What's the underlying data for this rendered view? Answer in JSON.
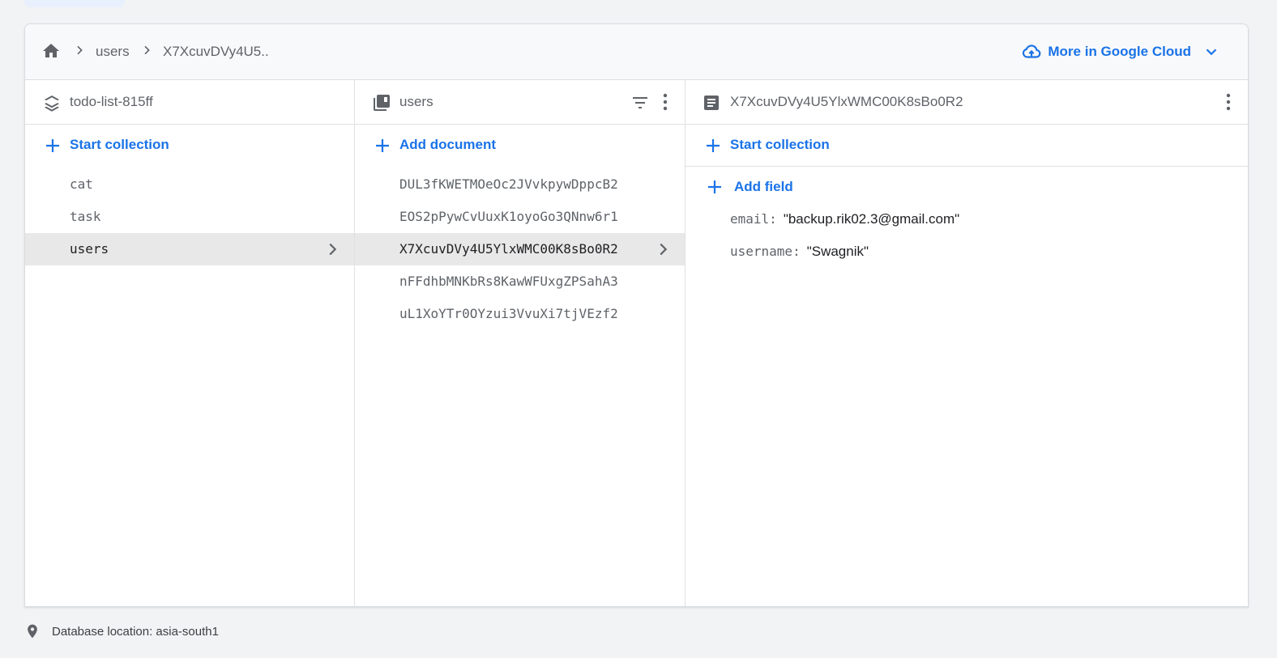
{
  "breadcrumb": {
    "items": [
      "users",
      "X7XcuvDVy4U5.."
    ],
    "more_link": "More in Google Cloud"
  },
  "columns": {
    "root": {
      "title": "todo-list-815ff",
      "action": "Start collection",
      "items": [
        "cat",
        "task",
        "users"
      ],
      "selected": 2
    },
    "collection": {
      "title": "users",
      "action": "Add document",
      "items": [
        "DUL3fKWETMOeOc2JVvkpywDppcB2",
        "EOS2pPywCvUuxK1oyoGo3QNnw6r1",
        "X7XcuvDVy4U5YlxWMC00K8sBo0R2",
        "nFFdhbMNKbRs8KawWFUxgZPSahA3",
        "uL1XoYTr0OYzui3VvuXi7tjVEzf2"
      ],
      "selected": 2
    },
    "document": {
      "title": "X7XcuvDVy4U5YlxWMC00K8sBo0R2",
      "action": "Start collection",
      "add_field": "Add field",
      "fields": [
        {
          "key": "email",
          "value": "\"backup.rik02.3@gmail.com\""
        },
        {
          "key": "username",
          "value": "\"Swagnik\""
        }
      ]
    }
  },
  "footer": {
    "location": "Database location: asia-south1"
  },
  "colors": {
    "accent": "#1a73e8",
    "selected_row": "#e8e8e8"
  },
  "icons": [
    "home-icon",
    "chevron-right-icon",
    "cloud-icon",
    "chevron-down-icon",
    "database-layers-icon",
    "collection-icon",
    "filter-icon",
    "more-vert-icon",
    "document-icon",
    "plus-icon",
    "location-pin-icon"
  ]
}
